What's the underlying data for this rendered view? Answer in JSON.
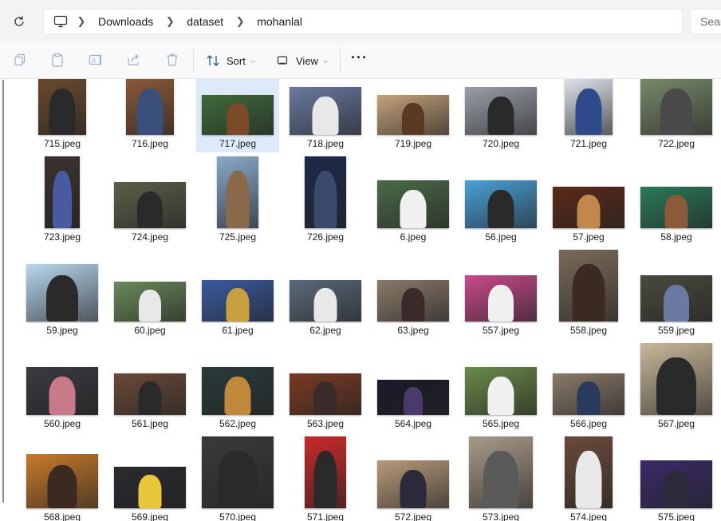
{
  "address_bar": {
    "breadcrumbs": [
      "Downloads",
      "dataset",
      "mohanlal"
    ],
    "search_placeholder": "Sear"
  },
  "toolbar": {
    "sort_label": "Sort",
    "view_label": "View",
    "more_label": "···"
  },
  "icons": {
    "refresh": "refresh-icon",
    "computer": "computer-icon",
    "copy": "copy-icon",
    "paste": "paste-icon",
    "rename": "rename-icon",
    "share": "share-icon",
    "delete": "delete-icon",
    "sort": "sort-icon",
    "view": "view-icon"
  },
  "colors": {
    "selection": "#dceaf9",
    "topbar": "#f3f3f3",
    "toolbar": "#f9f9f9"
  },
  "selected_file": "717.jpeg",
  "files": [
    {
      "name": "715.jpeg",
      "bg": "#6b4a2e",
      "fg": "#2a2a2a"
    },
    {
      "name": "716.jpeg",
      "bg": "#8c5a3a",
      "fg": "#3a4f7a"
    },
    {
      "name": "717.jpeg",
      "bg": "#3e6b3a",
      "fg": "#7a4a2a"
    },
    {
      "name": "718.jpeg",
      "bg": "#6a7aa0",
      "fg": "#e8e8e8"
    },
    {
      "name": "719.jpeg",
      "bg": "#c4a27a",
      "fg": "#5a3a22"
    },
    {
      "name": "720.jpeg",
      "bg": "#9aa0a8",
      "fg": "#2a2a2a"
    },
    {
      "name": "721.jpeg",
      "bg": "#dfe6ec",
      "fg": "#2f4a8a"
    },
    {
      "name": "722.jpeg",
      "bg": "#7a8a6a",
      "fg": "#4a4a4a"
    },
    {
      "name": "723.jpeg",
      "bg": "#3a3230",
      "fg": "#4a5aa0"
    },
    {
      "name": "724.jpeg",
      "bg": "#5a6048",
      "fg": "#2a2a2a"
    },
    {
      "name": "725.jpeg",
      "bg": "#8aa8c8",
      "fg": "#8a6a4a"
    },
    {
      "name": "726.jpeg",
      "bg": "#1e2a4a",
      "fg": "#3a4a6a"
    },
    {
      "name": "6.jpeg",
      "bg": "#4a6a48",
      "fg": "#f0f0f0"
    },
    {
      "name": "56.jpeg",
      "bg": "#4aa0d8",
      "fg": "#2a2a2a"
    },
    {
      "name": "57.jpeg",
      "bg": "#5a2a18",
      "fg": "#c0884a"
    },
    {
      "name": "58.jpeg",
      "bg": "#2a7a5a",
      "fg": "#8a5a3a"
    },
    {
      "name": "59.jpeg",
      "bg": "#b8d8ee",
      "fg": "#2a2a2a"
    },
    {
      "name": "60.jpeg",
      "bg": "#6a8a5a",
      "fg": "#e8e8e8"
    },
    {
      "name": "61.jpeg",
      "bg": "#3a5aa0",
      "fg": "#c8a040"
    },
    {
      "name": "62.jpeg",
      "bg": "#5a6a7a",
      "fg": "#e8e8e8"
    },
    {
      "name": "63.jpeg",
      "bg": "#8a7a6a",
      "fg": "#3a2a2a"
    },
    {
      "name": "557.jpeg",
      "bg": "#c84a8a",
      "fg": "#f0f0f0"
    },
    {
      "name": "558.jpeg",
      "bg": "#7a6a5a",
      "fg": "#3a2a22"
    },
    {
      "name": "559.jpeg",
      "bg": "#4a4a40",
      "fg": "#6a7aa0"
    },
    {
      "name": "560.jpeg",
      "bg": "#3a3a40",
      "fg": "#c87a8a"
    },
    {
      "name": "561.jpeg",
      "bg": "#6a4a38",
      "fg": "#2a2a2a"
    },
    {
      "name": "562.jpeg",
      "bg": "#2a3a3a",
      "fg": "#c0883a"
    },
    {
      "name": "563.jpeg",
      "bg": "#7a3a22",
      "fg": "#3a2a2a"
    },
    {
      "name": "564.jpeg",
      "bg": "#1a1a2a",
      "fg": "#4a3a6a"
    },
    {
      "name": "565.jpeg",
      "bg": "#6a8a4a",
      "fg": "#f0f0f0"
    },
    {
      "name": "566.jpeg",
      "bg": "#8a7a6a",
      "fg": "#2a3a5a"
    },
    {
      "name": "567.jpeg",
      "bg": "#c8b89a",
      "fg": "#2a2a2a"
    },
    {
      "name": "568.jpeg",
      "bg": "#c87a2a",
      "fg": "#3a2a22"
    },
    {
      "name": "569.jpeg",
      "bg": "#2a2a30",
      "fg": "#e8c83a"
    },
    {
      "name": "570.jpeg",
      "bg": "#3a3a38",
      "fg": "#2a2a2a"
    },
    {
      "name": "571.jpeg",
      "bg": "#c82a2a",
      "fg": "#2a2a2a"
    },
    {
      "name": "572.jpeg",
      "bg": "#b89a7a",
      "fg": "#2a2a3a"
    },
    {
      "name": "573.jpeg",
      "bg": "#a89a8a",
      "fg": "#5a5a5a"
    },
    {
      "name": "574.jpeg",
      "bg": "#6a4a3a",
      "fg": "#e8e8e8"
    },
    {
      "name": "575.jpeg",
      "bg": "#3a2a6a",
      "fg": "#2a2a3a"
    }
  ]
}
